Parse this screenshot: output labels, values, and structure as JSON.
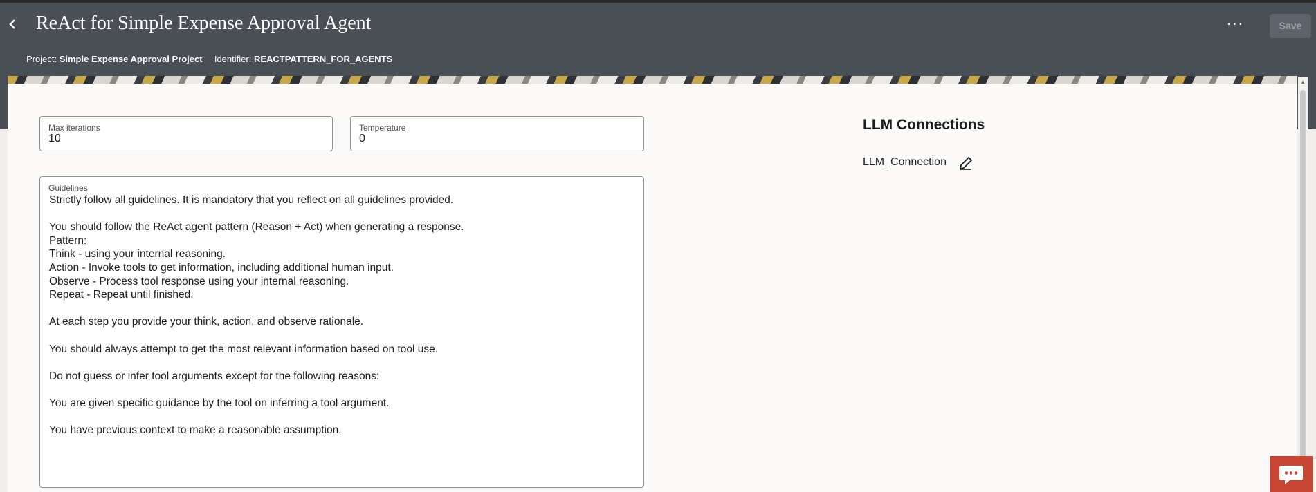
{
  "header": {
    "title": "ReAct for Simple Expense Approval Agent",
    "back_icon": "chevron-left-icon",
    "more_icon": "ellipsis-icon",
    "more_label": "···",
    "save_label": "Save",
    "project_label": "Project:",
    "project_value": "Simple Expense Approval Project",
    "identifier_label": "Identifier:",
    "identifier_value": "REACTPATTERN_FOR_AGENTS"
  },
  "form": {
    "max_iterations_label": "Max iterations",
    "max_iterations_value": "10",
    "temperature_label": "Temperature",
    "temperature_value": "0",
    "guidelines_label": "Guidelines",
    "guidelines_text": "Strictly follow all guidelines. It is mandatory that you reflect on all guidelines provided.\n\nYou should follow the ReAct agent pattern (Reason + Act) when generating a response.\nPattern:\nThink - using your internal reasoning.\nAction - Invoke tools to get information, including additional human input.\nObserve - Process tool response using your internal reasoning.\nRepeat - Repeat until finished.\n\nAt each step you provide your think, action, and observe rationale.\n\nYou should always attempt to get the most relevant information based on tool use.\n\nDo not guess or infer tool arguments except for the following reasons:\n\nYou are given specific guidance by the tool on inferring a tool argument.\n\nYou have previous context to make a reasonable assumption."
  },
  "llm": {
    "title": "LLM Connections",
    "connection_name": "LLM_Connection",
    "edit_icon": "pencil-icon"
  },
  "chat": {
    "icon": "chat-bubble-icon"
  },
  "colors": {
    "header_bg": "#4a4e55",
    "chat_accent": "#c74634",
    "panel_bg": "#fbfaf9"
  }
}
